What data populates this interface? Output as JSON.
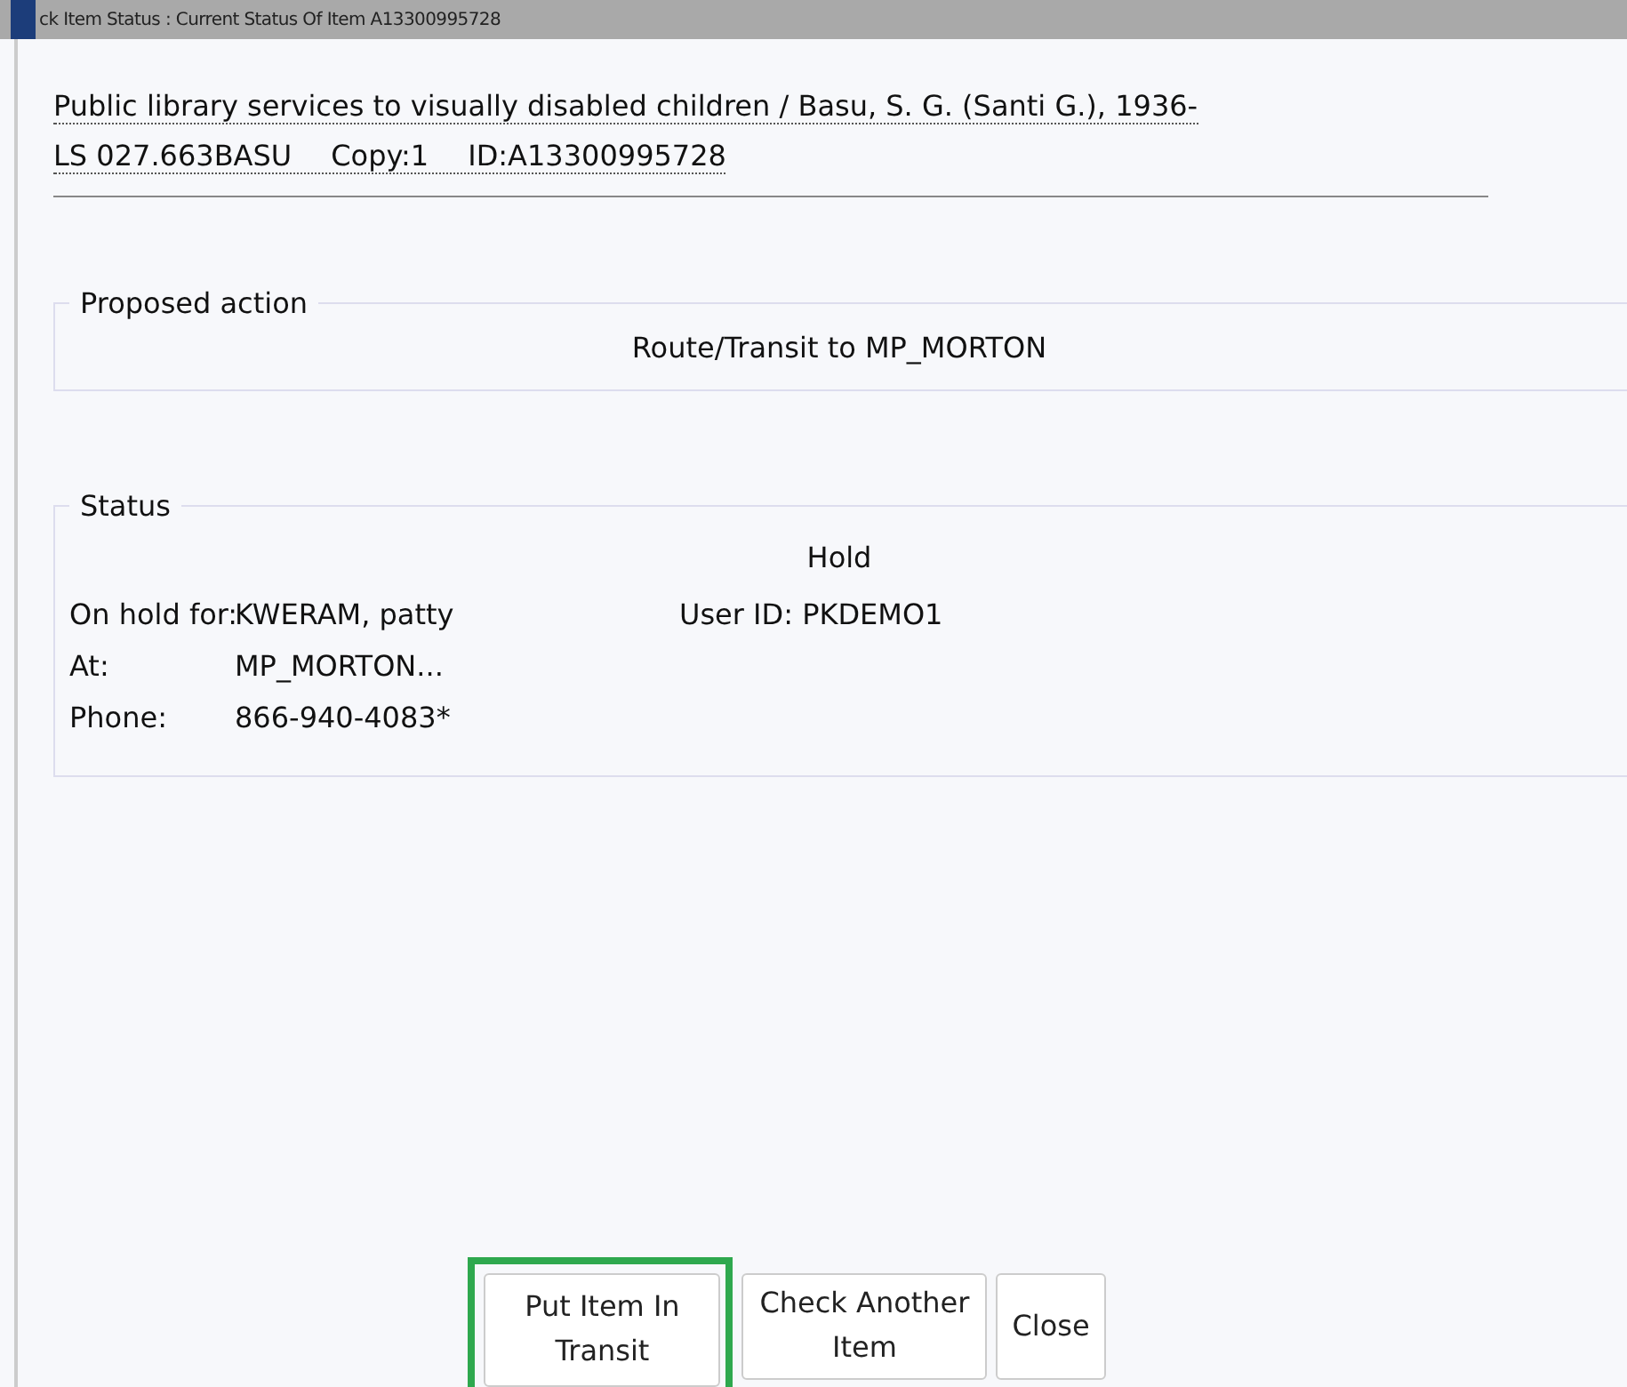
{
  "window": {
    "title": "ck Item Status : Current Status Of Item A13300995728"
  },
  "item": {
    "title": "Public library services to visually disabled children / Basu, S. G. (Santi G.), 1936-",
    "call_number": "LS 027.663BASU",
    "copy": "Copy:1",
    "id": "ID:A13300995728"
  },
  "proposed_action": {
    "legend": "Proposed action",
    "text": "Route/Transit to MP_MORTON"
  },
  "status": {
    "legend": "Status",
    "heading": "Hold",
    "rows": [
      {
        "label": "On hold for:",
        "value": "KWERAM, patty",
        "extra": "User ID: PKDEMO1"
      },
      {
        "label": "At:",
        "value": "MP_MORTON..."
      },
      {
        "label": "Phone:",
        "value": "866-940-4083*"
      }
    ]
  },
  "buttons": [
    {
      "label": "Put Item In Transit",
      "highlighted": true
    },
    {
      "label": "Check Another Item",
      "highlighted": false
    },
    {
      "label": "Close",
      "highlighted": false
    }
  ]
}
